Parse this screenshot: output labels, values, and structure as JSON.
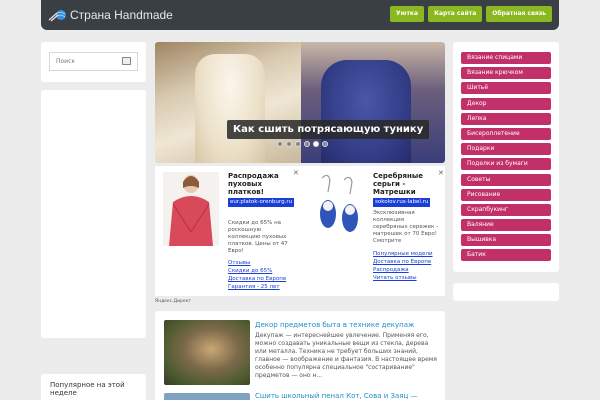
{
  "header": {
    "logo_text": "Страна Handmade",
    "nav": [
      "Уютка",
      "Карта сайта",
      "Обратная связь"
    ]
  },
  "search": {
    "placeholder": "Поиск"
  },
  "slider": {
    "caption": "Как сшить потрясающую тунику",
    "slide_count": 6,
    "active_slide": 5
  },
  "ads": [
    {
      "title": "Распродажа пуховых платков!",
      "domain": "eur.platok-orenburg.ru",
      "text": "Скидки до 65% на роскошную коллекцию пуховых платков. Цены от 47 Евро!",
      "links": [
        "Отзывы",
        "Скидки до 65%",
        "Доставка по Европе",
        "Гарантия - 25 лет"
      ]
    },
    {
      "title": "Серебряные серьги - Матрешки",
      "domain": "sokolov.rus-label.ru",
      "text": "Эксклюзивная коллекция серебряных сережек - матрешек от 70 Евро! Смотрите",
      "links": [
        "Популярные модели",
        "Доставка по Европе",
        "Распродажа",
        "Читать отзывы"
      ]
    }
  ],
  "ads_label": "Яндекс.Директ",
  "articles": [
    {
      "title": "Декор предметов быта в технике декупаж",
      "text": "Декупаж — интереснейшее увлечение. Применяя его, можно создавать уникальные вещи из стекла, дерева или металла. Техника не требует больших знаний, главное — воображение и фантазия. В настоящее время особенно популярна специальное \"состаривание\" предметов — оно н..."
    },
    {
      "title": "Сшить школьный пенал Кот, Сова и Заяц —"
    }
  ],
  "popular_title": "Популярное на этой неделе",
  "categories": [
    "Вязание спицами",
    "Вязание крючком",
    "Шитьё",
    "Декор",
    "Лепка",
    "Бисероплетение",
    "Подарки",
    "Поделки из бумаги",
    "Советы",
    "Рисование",
    "Скрапбукинг",
    "Валяние",
    "Вышивка",
    "Батик"
  ],
  "colors": {
    "accent_green": "#8ab820",
    "category_pink": "#c2306a",
    "link_blue": "#1e90c8"
  }
}
